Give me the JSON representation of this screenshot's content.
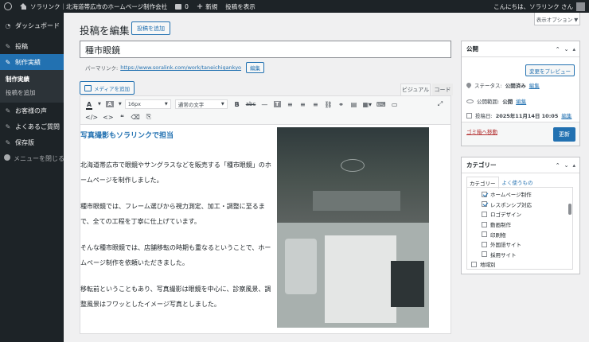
{
  "adminbar": {
    "site_name": "ソラリンク｜北海道帯広市のホームページ制作会社",
    "comments_count": "0",
    "new_label": "新規",
    "view_post_label": "投稿を表示",
    "greeting": "こんにちは、ソラリンク さん"
  },
  "sidebar": {
    "items": [
      {
        "label": "ダッシュボード",
        "icon": "gauge-icon"
      },
      {
        "label": "投稿",
        "icon": "pin-icon"
      },
      {
        "label": "制作実績",
        "icon": "pin-icon"
      },
      {
        "label": "お客様の声",
        "icon": "pin-icon"
      },
      {
        "label": "よくあるご質問",
        "icon": "pin-icon"
      },
      {
        "label": "保存版",
        "icon": "pin-icon"
      }
    ],
    "submenu": [
      "制作実績",
      "投稿を追加"
    ],
    "collapse_label": "メニューを閉じる"
  },
  "header": {
    "screen_options": "表示オプション ▼",
    "page_title": "投稿を編集",
    "add_new": "投稿を追加"
  },
  "post": {
    "title": "種市眼鏡",
    "permalink_label": "パーマリンク:",
    "permalink_url": "https://www.soralink.com/work/taneichigankyo",
    "edit_label": "編集"
  },
  "editor": {
    "add_media": "メディアを追加",
    "tab_visual": "ビジュアル",
    "tab_code": "コード",
    "font_size": "16px",
    "format": "通常の文字",
    "heading": "写真撮影もソラリンクで担当",
    "paragraphs": [
      "北海道帯広市で眼鏡やサングラスなどを販売する「種市眼鏡」のホームページを制作しました。",
      "種市眼鏡では、フレーム選びから視力測定、加工・調整に至るまで、全ての工程を丁寧に仕上げています。",
      "そんな種市眼鏡では、店舗移転の時期も重なるということで、ホームページ制作を依頼いただきました。",
      "移転前ということもあり、写真撮影は眼鏡を中心に、診察風景、調整風景はフワッとしたイメージ写真としました。"
    ]
  },
  "publish": {
    "title": "公開",
    "preview": "変更をプレビュー",
    "status_label": "ステータス:",
    "status_value": "公開済み",
    "status_edit": "編集",
    "visibility_label": "公開範囲:",
    "visibility_value": "公開",
    "visibility_edit": "編集",
    "date_label": "投稿日:",
    "date_value": "2025年11月14日 10:05",
    "date_edit": "編集",
    "trash": "ゴミ箱へ移動",
    "update": "更新"
  },
  "categories": {
    "title": "カテゴリー",
    "tab_all": "カテゴリー",
    "tab_popular": "よく使うもの",
    "items": [
      {
        "label": "ホームページ制作",
        "checked": true
      },
      {
        "label": "レスポンシブ対応",
        "checked": true
      },
      {
        "label": "ロゴデザイン",
        "checked": false
      },
      {
        "label": "動画制作",
        "checked": false
      },
      {
        "label": "印刷物",
        "checked": false
      },
      {
        "label": "外国語サイト",
        "checked": false
      },
      {
        "label": "採用サイト",
        "checked": false
      },
      {
        "label": "地域別",
        "checked": false
      }
    ]
  }
}
